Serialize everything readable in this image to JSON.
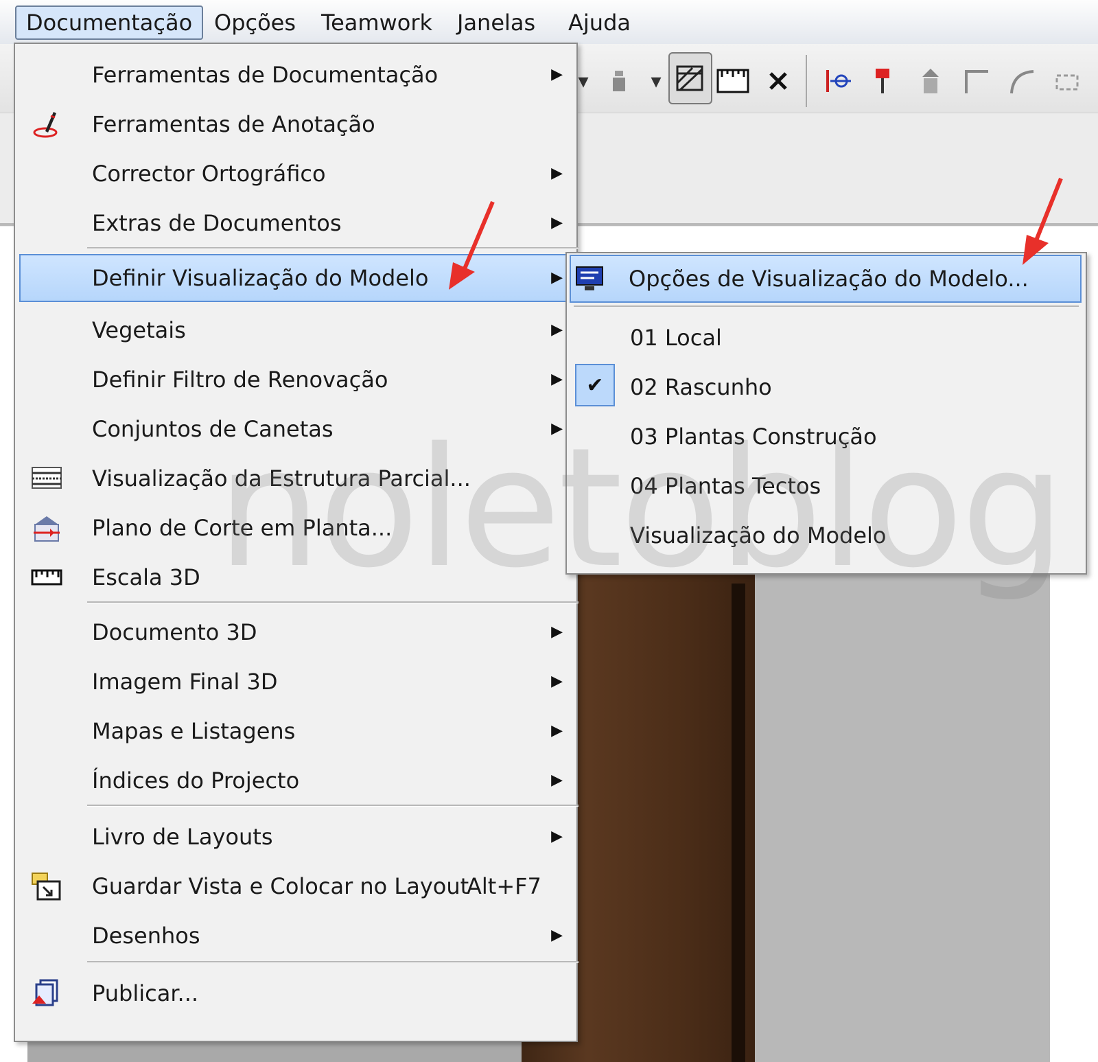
{
  "menubar": {
    "items": [
      "Documentação",
      "Opções",
      "Teamwork",
      "Janelas",
      "Ajuda"
    ]
  },
  "toolbar": {
    "icons": [
      "pen-icon",
      "pin-icon",
      "dropdown-icon",
      "hatch-tool-icon",
      "ruler-icon",
      "close-cross-icon",
      "section-icon",
      "marker-icon",
      "level-icon",
      "corner-icon",
      "arc-icon",
      "frame-icon"
    ]
  },
  "menu": {
    "items": [
      {
        "label": "Ferramentas de Documentação",
        "has_submenu": true,
        "icon": ""
      },
      {
        "label": "Ferramentas de Anotação",
        "has_submenu": false,
        "icon": "annotation-pen-icon"
      },
      {
        "label": "Corrector Ortográfico",
        "has_submenu": true,
        "icon": ""
      },
      {
        "label": "Extras de Documentos",
        "has_submenu": true,
        "icon": ""
      },
      {
        "label": "Definir Visualização do Modelo",
        "has_submenu": true,
        "icon": "",
        "highlighted": true
      },
      {
        "label": "Vegetais",
        "has_submenu": true,
        "icon": ""
      },
      {
        "label": "Definir Filtro de Renovação",
        "has_submenu": true,
        "icon": ""
      },
      {
        "label": "Conjuntos de Canetas",
        "has_submenu": true,
        "icon": ""
      },
      {
        "label": "Visualização da Estrutura Parcial...",
        "has_submenu": false,
        "icon": "partial-structure-icon"
      },
      {
        "label": "Plano de Corte em Planta...",
        "has_submenu": false,
        "icon": "cut-plane-icon"
      },
      {
        "label": "Escala 3D",
        "has_submenu": false,
        "icon": "scale-ruler-icon"
      },
      {
        "label": "Documento 3D",
        "has_submenu": true,
        "icon": ""
      },
      {
        "label": "Imagem Final 3D",
        "has_submenu": true,
        "icon": ""
      },
      {
        "label": "Mapas e Listagens",
        "has_submenu": true,
        "icon": ""
      },
      {
        "label": "Índices do Projecto",
        "has_submenu": true,
        "icon": ""
      },
      {
        "label": "Livro de Layouts",
        "has_submenu": true,
        "icon": ""
      },
      {
        "label": "Guardar Vista e Colocar no Layout",
        "shortcut": "Alt+F7",
        "has_submenu": false,
        "icon": "save-view-icon"
      },
      {
        "label": "Desenhos",
        "has_submenu": true,
        "icon": ""
      },
      {
        "label": "Publicar...",
        "has_submenu": false,
        "icon": "publish-icon"
      }
    ]
  },
  "submenu": {
    "items": [
      {
        "label": "Opções de Visualização do Modelo...",
        "highlighted": true,
        "icon": "monitor-options-icon"
      },
      {
        "label": "01 Local",
        "checked": false
      },
      {
        "label": "02 Rascunho",
        "checked": true
      },
      {
        "label": "03 Plantas Construção",
        "checked": false
      },
      {
        "label": "04 Plantas Tectos",
        "checked": false
      },
      {
        "label": "Visualização do Modelo",
        "checked": false
      }
    ]
  },
  "watermark": "noletoblog",
  "colors": {
    "highlight": "#b6d6fb",
    "highlight_border": "#5b8fd6",
    "menu_bg": "#f1f1f1",
    "annotation_arrow": "#e8302a"
  }
}
